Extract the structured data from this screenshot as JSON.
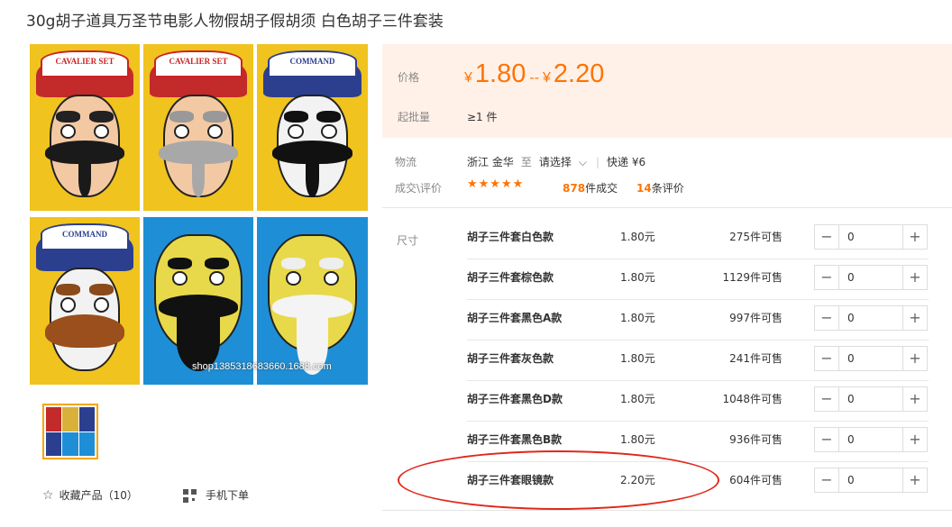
{
  "product": {
    "title": "30g胡子道具万圣节电影人物假胡子假胡须 白色胡子三件套装"
  },
  "gallery": {
    "card_label_1": "CAVALIER SET",
    "card_label_2": "CAVALIER SET",
    "card_label_3": "COMMAND",
    "card_label_4": "COMMAND",
    "watermark": "shop1385318683660.1688.com"
  },
  "actions": {
    "favorite_label": "收藏产品（10）",
    "mobile_label": "手机下单"
  },
  "price": {
    "label": "价格",
    "currency": "¥",
    "low": "1.80",
    "dash": "--",
    "high": "2.20"
  },
  "moq": {
    "label": "起批量",
    "value": "≥1 件"
  },
  "logistics": {
    "label": "物流",
    "origin": "浙江 金华",
    "to": "至",
    "destination": "请选择",
    "shipping": "快递 ¥6"
  },
  "deals": {
    "label": "成交\\评价",
    "stars": "★★★★★",
    "count": "878",
    "count_suffix": "件成交",
    "reviews": "14",
    "reviews_suffix": "条评价"
  },
  "sizes": {
    "label": "尺寸",
    "rows": [
      {
        "name": "胡子三件套白色款",
        "price": "1.80元",
        "stock": "275件可售",
        "qty": "0"
      },
      {
        "name": "胡子三件套棕色款",
        "price": "1.80元",
        "stock": "1129件可售",
        "qty": "0"
      },
      {
        "name": "胡子三件套黑色A款",
        "price": "1.80元",
        "stock": "997件可售",
        "qty": "0"
      },
      {
        "name": "胡子三件套灰色款",
        "price": "1.80元",
        "stock": "241件可售",
        "qty": "0"
      },
      {
        "name": "胡子三件套黑色D款",
        "price": "1.80元",
        "stock": "1048件可售",
        "qty": "0"
      },
      {
        "name": "胡子三件套黑色B款",
        "price": "1.80元",
        "stock": "936件可售",
        "qty": "0"
      },
      {
        "name": "胡子三件套眼镜款",
        "price": "2.20元",
        "stock": "604件可售",
        "qty": "0"
      }
    ],
    "minus_symbol": "−",
    "plus_symbol": "+"
  },
  "colors": {
    "accent": "#ff7300",
    "price_bg": "#fff1e8",
    "annotation": "#e0281c",
    "thumb_border": "#f7a400"
  }
}
